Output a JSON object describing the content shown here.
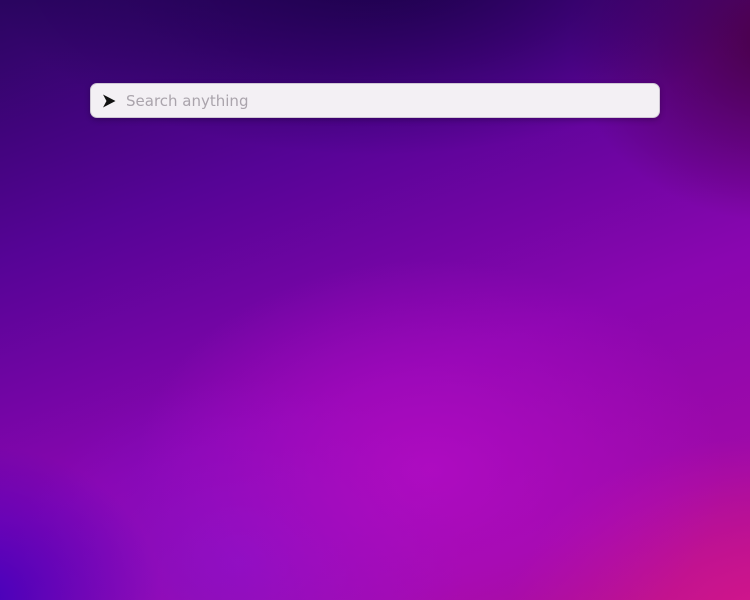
{
  "desktop": {
    "background_colors": {
      "top": "#2a0560",
      "center": "#8a06b0",
      "bottom_right": "#b0108a"
    }
  },
  "launcher": {
    "icon": "chevron-right-icon",
    "search": {
      "value": "",
      "placeholder": "Search anything"
    },
    "colors": {
      "bar_background": "#f3f0f4",
      "placeholder": "#aaa4ac",
      "icon": "#111111"
    }
  }
}
